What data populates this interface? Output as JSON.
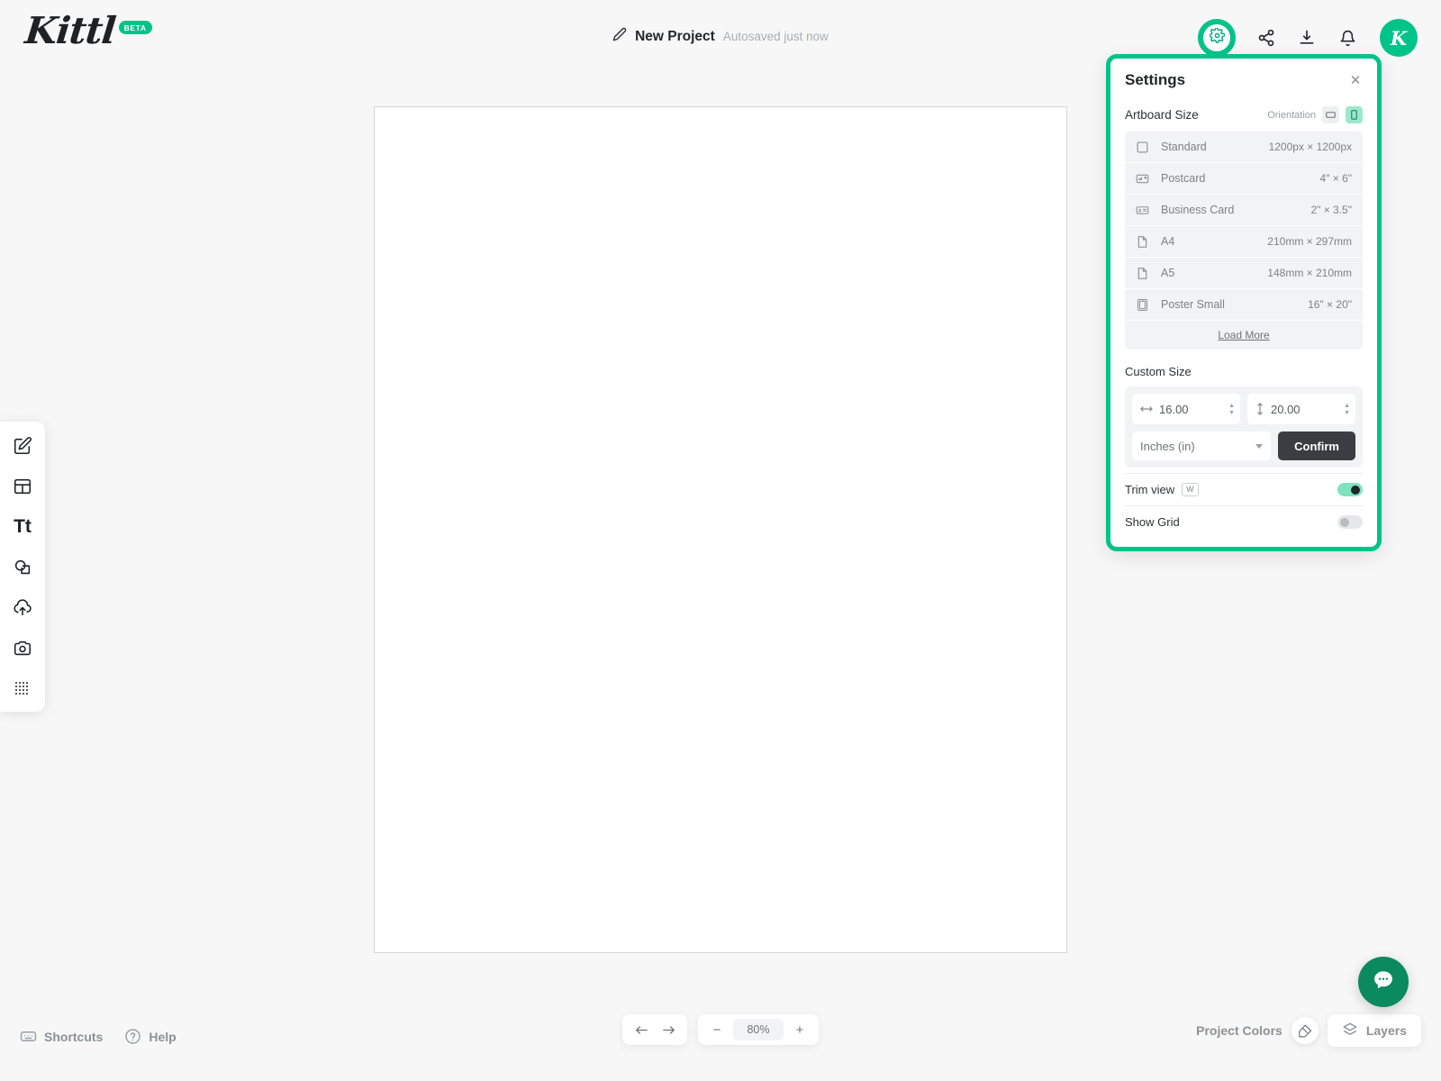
{
  "header": {
    "logo_text": "Kittl",
    "logo_badge": "BETA",
    "project_title": "New Project",
    "autosave_text": "Autosaved just now",
    "icons": {
      "edit": "pencil-icon",
      "settings": "gear-icon",
      "share": "share-icon",
      "download": "download-icon",
      "notifications": "bell-icon"
    },
    "avatar_letter": "K"
  },
  "toolbar": {
    "items": [
      {
        "name": "design-tool",
        "icon": "pencil-square-icon"
      },
      {
        "name": "templates-tool",
        "icon": "layout-icon"
      },
      {
        "name": "text-tool",
        "icon": "text-icon",
        "label": "Tt"
      },
      {
        "name": "shapes-tool",
        "icon": "shapes-icon"
      },
      {
        "name": "upload-tool",
        "icon": "cloud-upload-icon"
      },
      {
        "name": "photos-tool",
        "icon": "camera-icon"
      },
      {
        "name": "elements-tool",
        "icon": "grid-dots-icon"
      }
    ]
  },
  "settings": {
    "title": "Settings",
    "close_icon": "close-icon",
    "artboard_size_label": "Artboard Size",
    "orientation_label": "Orientation",
    "orientation_selected": "portrait",
    "sizes": [
      {
        "name": "Standard",
        "dimensions": "1200px × 1200px",
        "icon": "square-icon"
      },
      {
        "name": "Postcard",
        "dimensions": "4\" × 6\"",
        "icon": "postcard-icon"
      },
      {
        "name": "Business Card",
        "dimensions": "2\" × 3.5\"",
        "icon": "business-card-icon"
      },
      {
        "name": "A4",
        "dimensions": "210mm × 297mm",
        "icon": "document-icon"
      },
      {
        "name": "A5",
        "dimensions": "148mm × 210mm",
        "icon": "document-icon"
      },
      {
        "name": "Poster Small",
        "dimensions": "16\" × 20\"",
        "icon": "poster-icon"
      }
    ],
    "load_more_label": "Load More",
    "custom_size_label": "Custom Size",
    "width_value": "16.00",
    "height_value": "20.00",
    "unit_selected": "Inches (in)",
    "confirm_label": "Confirm",
    "trim_view": {
      "label": "Trim view",
      "shortcut": "W",
      "state": "on"
    },
    "show_grid": {
      "label": "Show Grid",
      "state": "off"
    }
  },
  "bottom": {
    "shortcuts_label": "Shortcuts",
    "help_label": "Help",
    "undo_icon": "undo-arrow-icon",
    "redo_icon": "redo-arrow-icon",
    "zoom_out_label": "−",
    "zoom_level": "80%",
    "zoom_in_label": "+",
    "project_colors_label": "Project Colors",
    "layers_label": "Layers"
  },
  "colors": {
    "accent": "#00c38a",
    "accent_soft": "#7fe3c0",
    "chat_green": "#0b8a5f",
    "dark": "#24262a",
    "muted": "#8d9196",
    "panel_row_bg": "#f2f3f4"
  }
}
